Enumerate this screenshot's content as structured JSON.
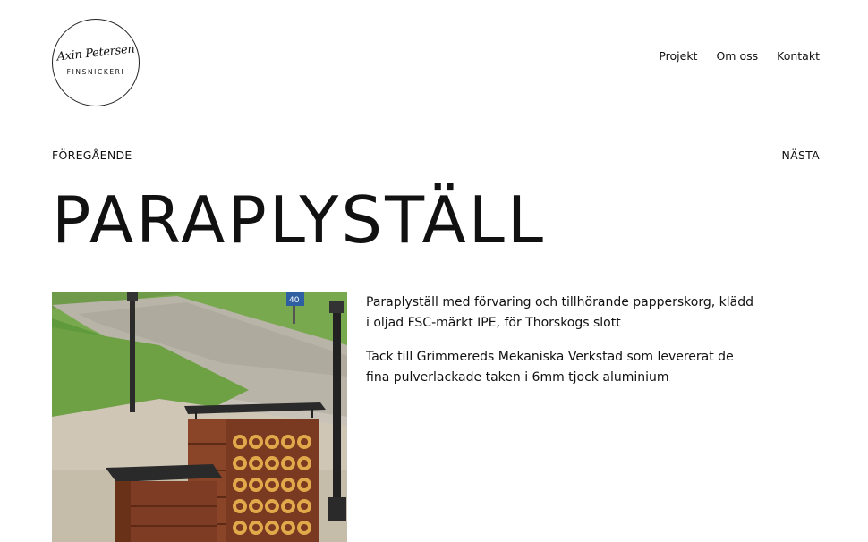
{
  "brand": {
    "script": "Axin Petersen",
    "sub": "FINSNICKERI"
  },
  "nav": {
    "projekt": "Projekt",
    "om_oss": "Om oss",
    "kontakt": "Kontakt"
  },
  "pager": {
    "previous": "FÖREGÅENDE",
    "next": "NÄSTA"
  },
  "page": {
    "title": "PARAPLYSTÄLL"
  },
  "description": {
    "paragraph1": "Paraplyställ med förvaring och tillhörande papperskorg, klädd i oljad FSC-märkt IPE, för Thorskogs slott",
    "paragraph2": "Tack till Grimmereds Mekaniska Verkstad som levererat de fina pulverlackade taken i 6mm tjock aluminium"
  },
  "photo": {
    "sign_text": "40"
  }
}
